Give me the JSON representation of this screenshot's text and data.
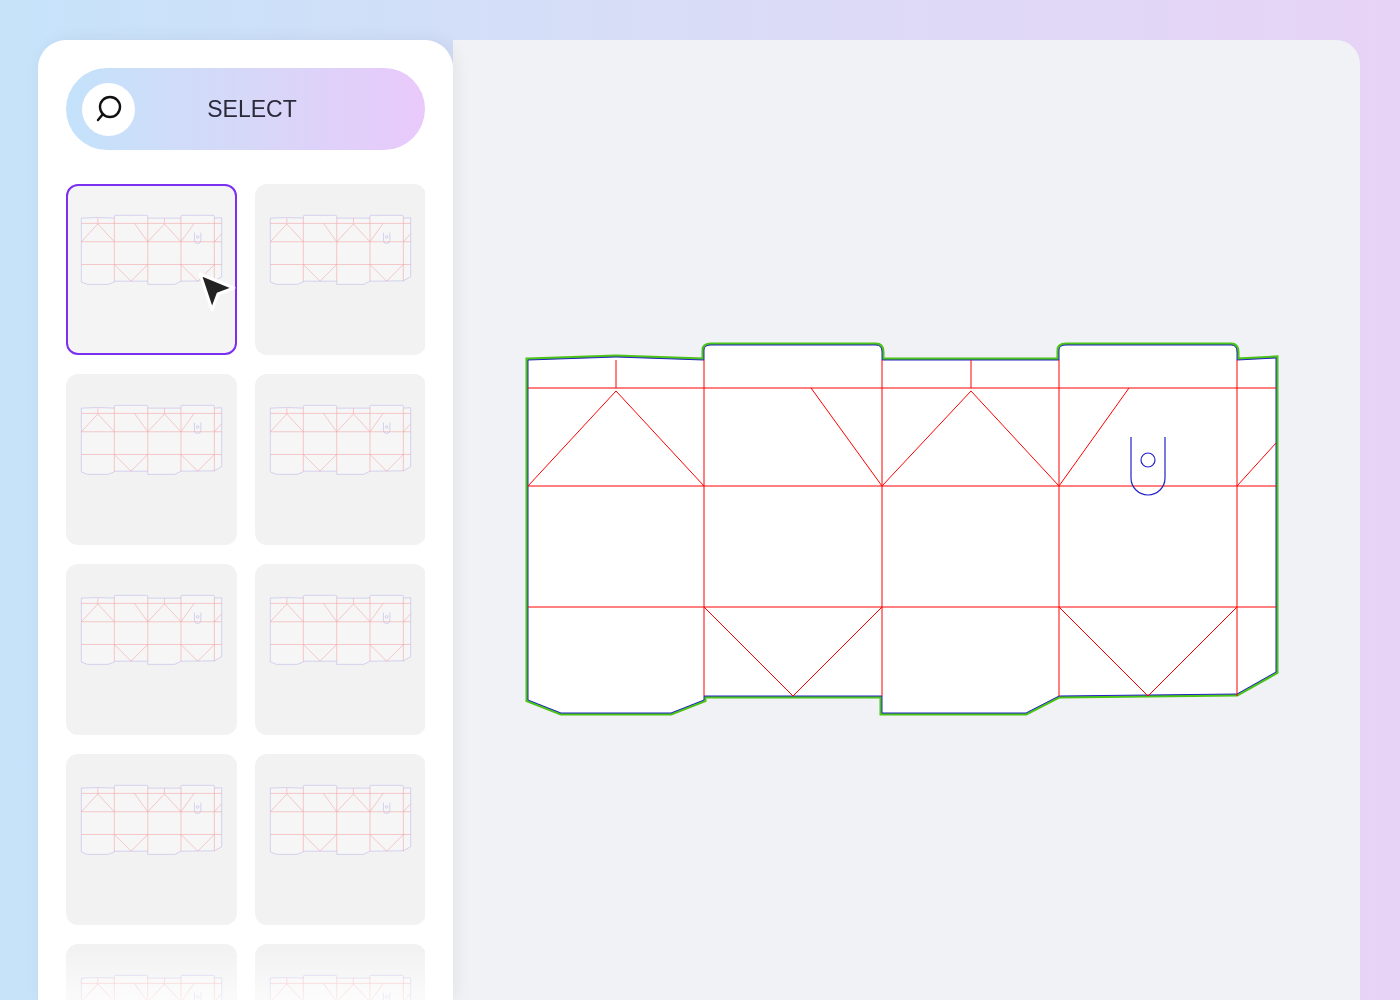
{
  "select_button": {
    "label": "SELECT"
  },
  "templates": [
    {
      "selected": true
    },
    {
      "selected": false
    },
    {
      "selected": false
    },
    {
      "selected": false
    },
    {
      "selected": false
    },
    {
      "selected": false
    },
    {
      "selected": false
    },
    {
      "selected": false
    },
    {
      "selected": false
    },
    {
      "selected": false
    }
  ]
}
